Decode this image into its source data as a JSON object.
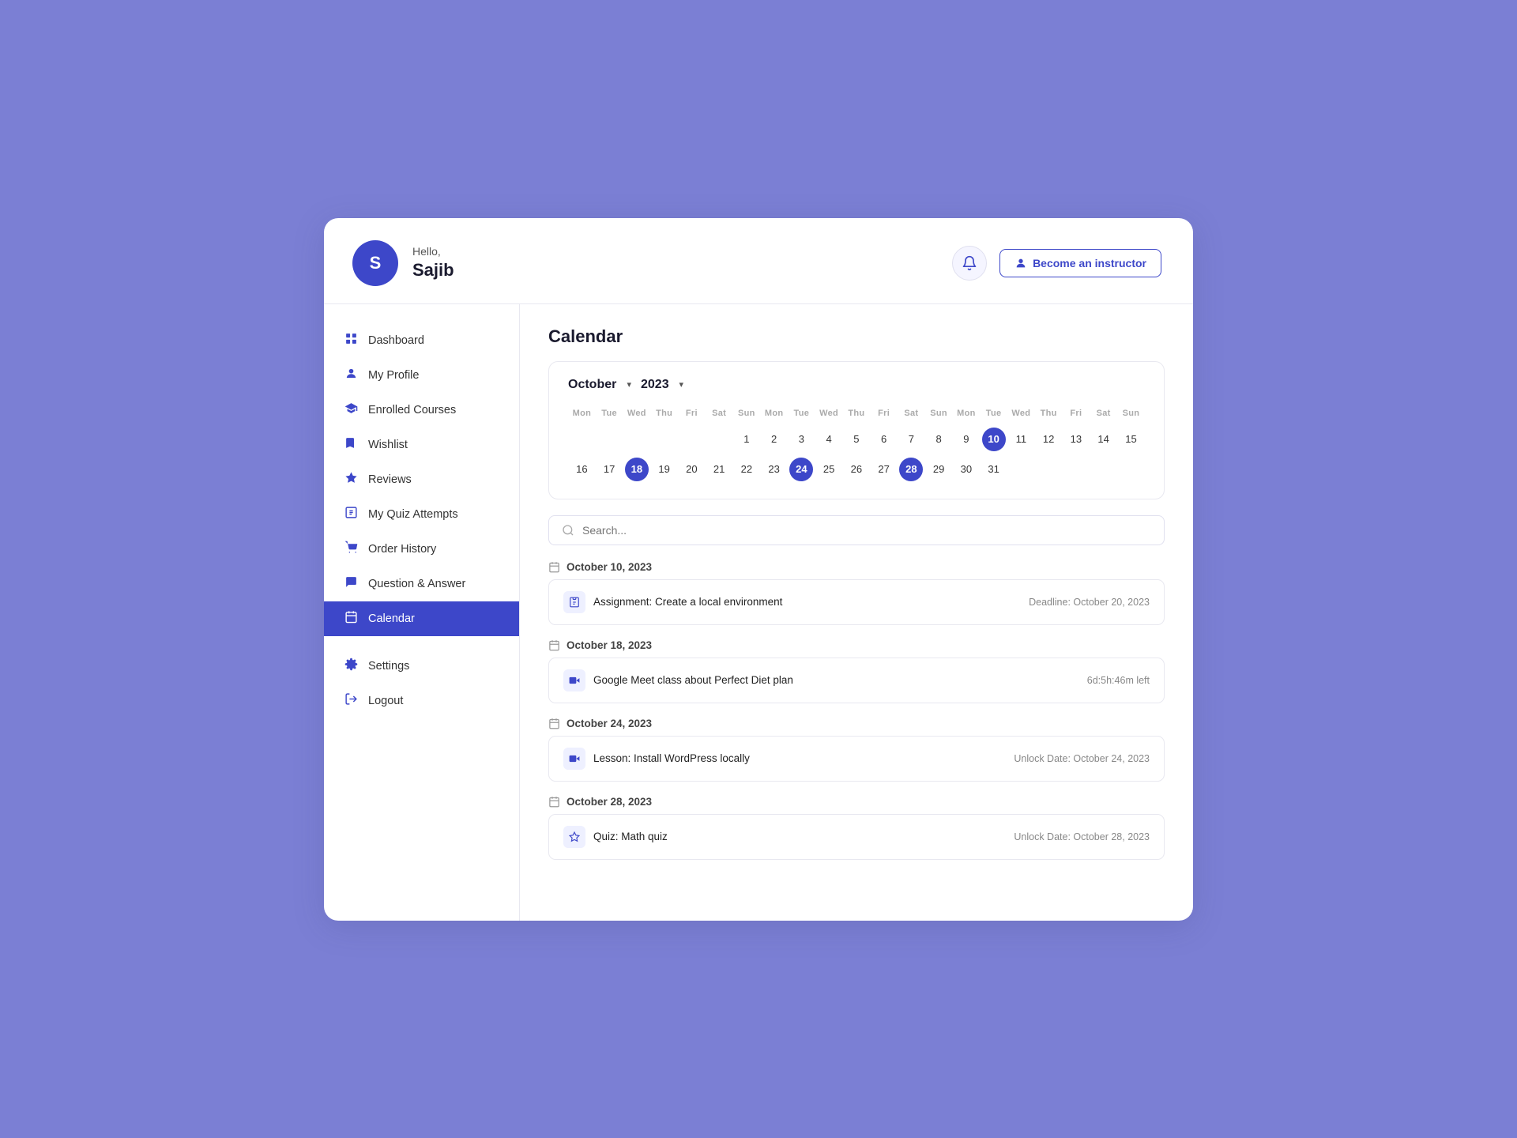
{
  "header": {
    "avatar_letter": "S",
    "greeting_hello": "Hello,",
    "greeting_name": "Sajib",
    "bell_icon": "🔔",
    "instructor_btn_label": "Become an instructor",
    "instructor_icon": "👤"
  },
  "sidebar": {
    "items": [
      {
        "id": "dashboard",
        "label": "Dashboard",
        "icon": "⊞",
        "active": false
      },
      {
        "id": "my-profile",
        "label": "My Profile",
        "icon": "👤",
        "active": false
      },
      {
        "id": "enrolled-courses",
        "label": "Enrolled Courses",
        "icon": "🎓",
        "active": false
      },
      {
        "id": "wishlist",
        "label": "Wishlist",
        "icon": "🔖",
        "active": false
      },
      {
        "id": "reviews",
        "label": "Reviews",
        "icon": "⭐",
        "active": false
      },
      {
        "id": "quiz-attempts",
        "label": "My Quiz Attempts",
        "icon": "⊟",
        "active": false
      },
      {
        "id": "order-history",
        "label": "Order History",
        "icon": "🛒",
        "active": false
      },
      {
        "id": "question-answer",
        "label": "Question & Answer",
        "icon": "💬",
        "active": false
      },
      {
        "id": "calendar",
        "label": "Calendar",
        "icon": "📅",
        "active": true
      },
      {
        "id": "settings",
        "label": "Settings",
        "icon": "⚙",
        "active": false
      },
      {
        "id": "logout",
        "label": "Logout",
        "icon": "➜",
        "active": false
      }
    ]
  },
  "main": {
    "page_title": "Calendar",
    "calendar": {
      "month_label": "October",
      "year_label": "2023",
      "day_headers": [
        "Mon",
        "Tue",
        "Wed",
        "Thu",
        "Fri",
        "Sat",
        "Sun",
        "Mon",
        "Tue",
        "Wed",
        "Thu",
        "Fri",
        "Sat",
        "Sun",
        "Mon",
        "Tue",
        "Wed",
        "Thu",
        "Fri",
        "Sat",
        "Sun"
      ],
      "rows": [
        [
          null,
          null,
          null,
          null,
          null,
          null,
          1,
          2,
          3,
          4,
          5,
          6,
          7,
          8,
          9,
          "10h",
          11,
          12,
          13,
          14,
          15
        ],
        [
          16,
          17,
          "18h",
          19,
          20,
          21,
          22,
          23,
          "24h",
          25,
          26,
          27,
          "28h",
          29,
          30,
          31,
          null,
          null,
          null,
          null,
          null
        ]
      ]
    },
    "search_placeholder": "Search...",
    "events": [
      {
        "date": "October 10, 2023",
        "items": [
          {
            "type": "assignment",
            "icon": "📋",
            "title": "Assignment:  Create a local environment",
            "meta": "Deadline: October 20, 2023"
          }
        ]
      },
      {
        "date": "October 18, 2023",
        "items": [
          {
            "type": "meet",
            "icon": "▶",
            "title": "Google Meet class about Perfect Diet plan",
            "meta": "6d:5h:46m left"
          }
        ]
      },
      {
        "date": "October 24, 2023",
        "items": [
          {
            "type": "lesson",
            "icon": "▶",
            "title": "Lesson:  Install WordPress locally",
            "meta": "Unlock Date: October 24, 2023"
          }
        ]
      },
      {
        "date": "October 28, 2023",
        "items": [
          {
            "type": "quiz",
            "icon": "☆",
            "title": "Quiz:  Math quiz",
            "meta": "Unlock Date: October 28, 2023"
          }
        ]
      }
    ]
  }
}
